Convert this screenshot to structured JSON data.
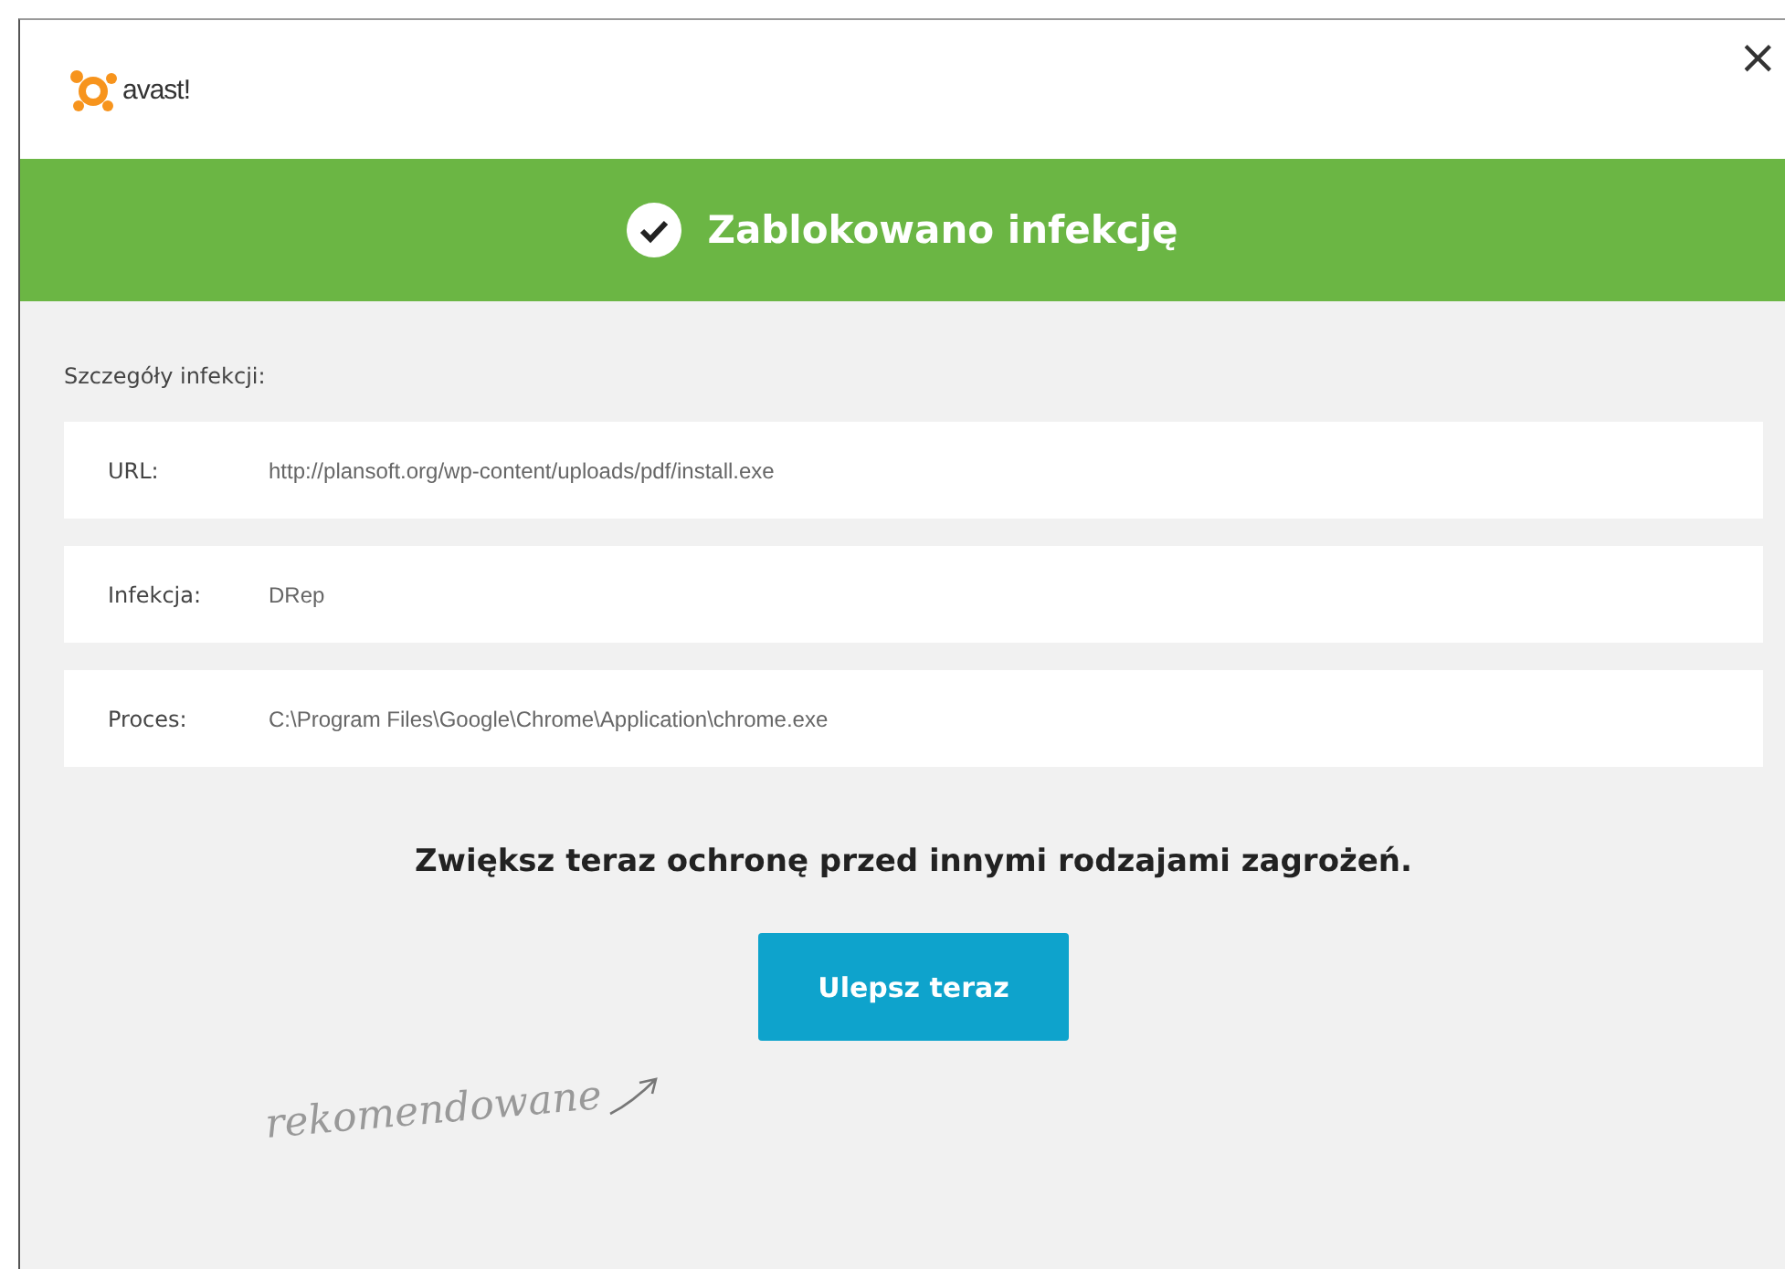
{
  "window": {
    "logo_text": "avast!",
    "close": "×"
  },
  "banner": {
    "title": "Zablokowano infekcję"
  },
  "details": {
    "heading": "Szczegóły infekcji:",
    "rows": [
      {
        "label": "URL:",
        "value": "http://plansoft.org/wp-content/uploads/pdf/install.exe"
      },
      {
        "label": "Infekcja:",
        "value": "DRep"
      },
      {
        "label": "Proces:",
        "value": "C:\\Program Files\\Google\\Chrome\\Application\\chrome.exe"
      }
    ]
  },
  "promo": {
    "text": "Zwiększ teraz ochronę przed innymi rodzajami zagrożeń.",
    "button": "Ulepsz teraz",
    "note": "rekomendowane"
  }
}
